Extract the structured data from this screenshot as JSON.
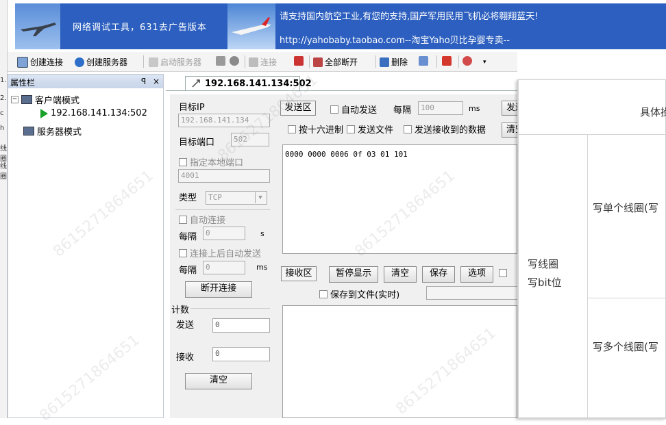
{
  "banner": {
    "tool_name": "网络调试工具，631去广告版本",
    "slogan": "请支持国内航空工业,有您的支持,国产军用民用飞机必将翱翔蓝天!",
    "shop_link": "http://yahobaby.taobao.com--淘宝Yaho贝比孕婴专卖--"
  },
  "left_strip": [
    "1.",
    "2.",
    "c",
    "h",
    "线圈",
    "线圈"
  ],
  "toolbar": {
    "create_connection": "创建连接",
    "create_server": "创建服务器",
    "start_server": "启动服务器",
    "connect": "连接",
    "disconnect_all": "全部断开",
    "delete": "删除"
  },
  "property_pane": {
    "title": "属性栏",
    "pin": "ꟼ",
    "close": "×",
    "client_mode": "客户端模式",
    "client_item": "192.168.141.134:502",
    "server_mode": "服务器模式"
  },
  "tab": {
    "label": "192.168.141.134:502"
  },
  "settings": {
    "target_ip_label": "目标IP",
    "target_ip_value": "192.168.141.134",
    "target_port_label": "目标端口",
    "target_port_value": "502",
    "local_port_label": "指定本地端口",
    "local_port_value": "4001",
    "type_label": "类型",
    "type_value": "TCP",
    "auto_connect_label": "自动连接",
    "interval_label": "每隔",
    "interval_value": "0",
    "interval_unit": "s",
    "auto_send_label": "连接上后自动发送",
    "interval2_label": "每隔",
    "interval2_value": "0",
    "interval2_unit": "ms",
    "disconnect_button": "断开连接",
    "count_label": "计数",
    "send_count_label": "发送",
    "send_count_value": "0",
    "recv_count_label": "接收",
    "recv_count_value": "0",
    "clear_button": "清空"
  },
  "send": {
    "area_label": "发送区",
    "auto_send": "自动发送",
    "interval_label": "每隔",
    "interval_value": "100",
    "interval_unit": "ms",
    "send_button": "发送",
    "hex_label": "按十六进制",
    "send_file_label": "发送文件",
    "send_received_label": "发送接收到的数据",
    "clear_button": "清空",
    "content": "0000 0000 0006 0f 03 01 101"
  },
  "receive": {
    "area_label": "接收区",
    "pause_button": "暂停显示",
    "clear_button": "清空",
    "save_button": "保存",
    "options_button": "选项",
    "save_to_file_label": "保存到文件(实时)"
  },
  "doc_table": {
    "header_fragment": "具体操",
    "row_group_line1": "写线圈",
    "row_group_line2": "写bit位",
    "single_coil": "写单个线圈(写",
    "multi_coil": "写多个线圈(写"
  },
  "watermark": "8615271864651"
}
